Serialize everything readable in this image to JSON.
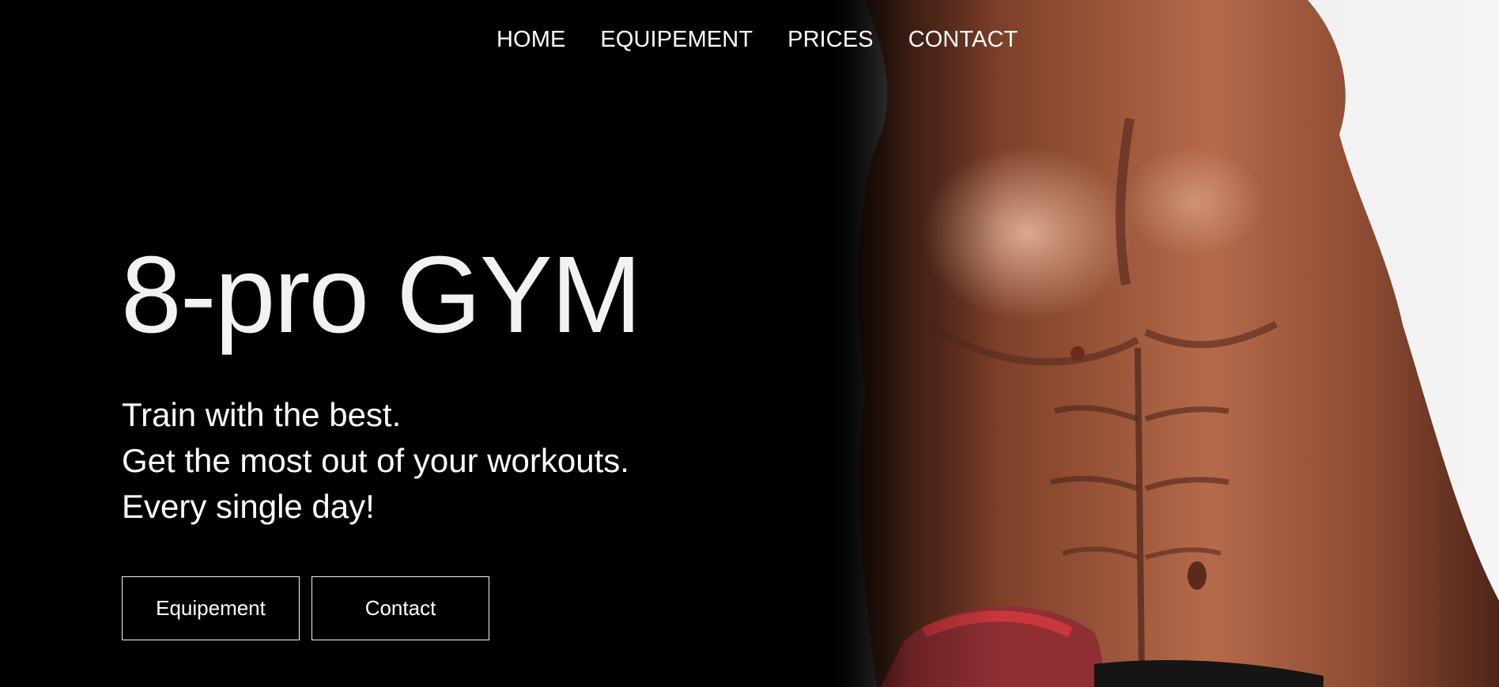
{
  "nav": {
    "items": [
      {
        "label": "HOME"
      },
      {
        "label": "EQUIPEMENT"
      },
      {
        "label": "PRICES"
      },
      {
        "label": "CONTACT"
      }
    ]
  },
  "hero": {
    "title": "8-pro GYM",
    "tagline": [
      "Train with the best.",
      "Get the most out of your workouts.",
      "Every single day!"
    ],
    "buttons": [
      {
        "label": "Equipement"
      },
      {
        "label": "Contact"
      }
    ],
    "image_subject": "muscular-torso-photo"
  },
  "colors": {
    "background": "#000000",
    "text": "#ffffff",
    "skin": "#a05a40",
    "accent": "#c8373c"
  }
}
